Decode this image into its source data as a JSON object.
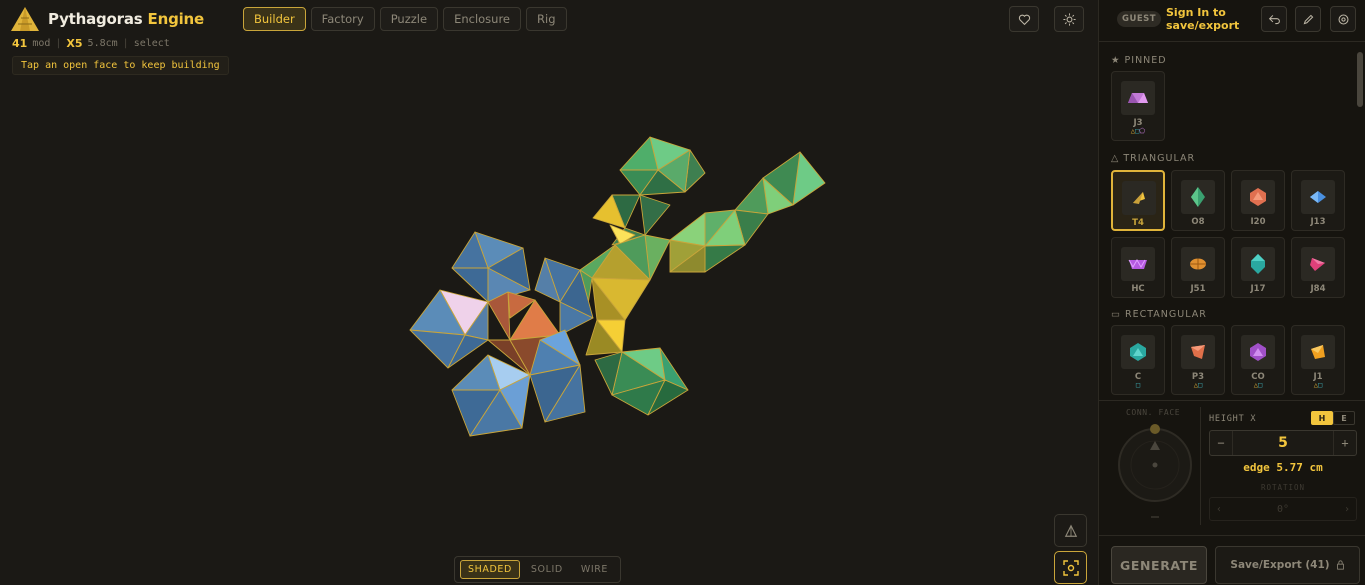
{
  "brand": {
    "title_part1": "Pythagoras",
    "title_part2": "Engine"
  },
  "tabs": [
    {
      "label": "Builder",
      "active": true
    },
    {
      "label": "Factory"
    },
    {
      "label": "Puzzle"
    },
    {
      "label": "Enclosure"
    },
    {
      "label": "Rig"
    }
  ],
  "stats": {
    "module_count": "41",
    "module_unit": "mod",
    "scale": "X5",
    "scale_size": "5.8cm",
    "mode": "select"
  },
  "hint": "Tap an open face to keep building",
  "toolbar": {
    "favorite_icon": "heart-icon",
    "theme_icon": "sun-icon"
  },
  "render_modes": [
    {
      "label": "SHADED",
      "active": true
    },
    {
      "label": "SOLID"
    },
    {
      "label": "WIRE"
    }
  ],
  "panel": {
    "guest_badge": "GUEST",
    "signin": "Sign In to save/export",
    "sections": {
      "pinned": "★ PINNED",
      "triangular": "△ TRIANGULAR",
      "rectangular": "▭ RECTANGULAR"
    },
    "pinned": [
      {
        "name": "J3",
        "faces": "△□⬠"
      }
    ],
    "triangular": [
      {
        "name": "T4",
        "selected": true
      },
      {
        "name": "O8"
      },
      {
        "name": "I20"
      },
      {
        "name": "J13"
      },
      {
        "name": "HC"
      },
      {
        "name": "J51"
      },
      {
        "name": "J17"
      },
      {
        "name": "J84"
      }
    ],
    "rectangular": [
      {
        "name": "C",
        "faces": "□"
      },
      {
        "name": "P3",
        "faces": "△□"
      },
      {
        "name": "CO",
        "faces": "△□"
      },
      {
        "name": "J1",
        "faces": "△□"
      }
    ],
    "conn_face_label": "CONN. FACE",
    "height_label": "HEIGHT X",
    "height_modes": [
      "H",
      "E"
    ],
    "height_value": "5",
    "edge_text": "edge 5.77 cm",
    "rotation_label": "ROTATION",
    "rotation_value": "0°",
    "generate_label": "GENERATE",
    "save_label": "Save/Export (41)"
  }
}
